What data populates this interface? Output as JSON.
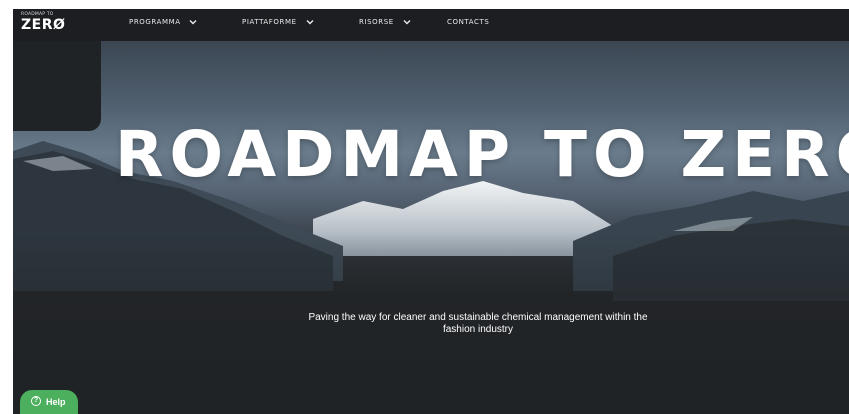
{
  "logo": {
    "small_text": "ROADMAP TO",
    "big_text": "ZERØ"
  },
  "nav": {
    "items": [
      {
        "label": "PROGRAMMA",
        "has_dropdown": true,
        "icon": "chevron-down-icon"
      },
      {
        "label": "PIATTAFORME",
        "has_dropdown": true,
        "icon": "chevron-down-icon"
      },
      {
        "label": "RISORSE",
        "has_dropdown": true,
        "icon": "chevron-down-icon"
      },
      {
        "label": "CONTACTS",
        "has_dropdown": false
      }
    ]
  },
  "hero": {
    "title": "ROADMAP TO ZERO",
    "subtitle_line1": "Paving the way for cleaner and sustainable chemical management within the",
    "subtitle_line2": "fashion industry"
  },
  "help": {
    "label": "Help",
    "icon": "question-circle-icon",
    "color": "#4caf5d"
  },
  "colors": {
    "navbar": "#1c1e21",
    "hero_dark": "#202326",
    "accent": "#4caf5d"
  }
}
